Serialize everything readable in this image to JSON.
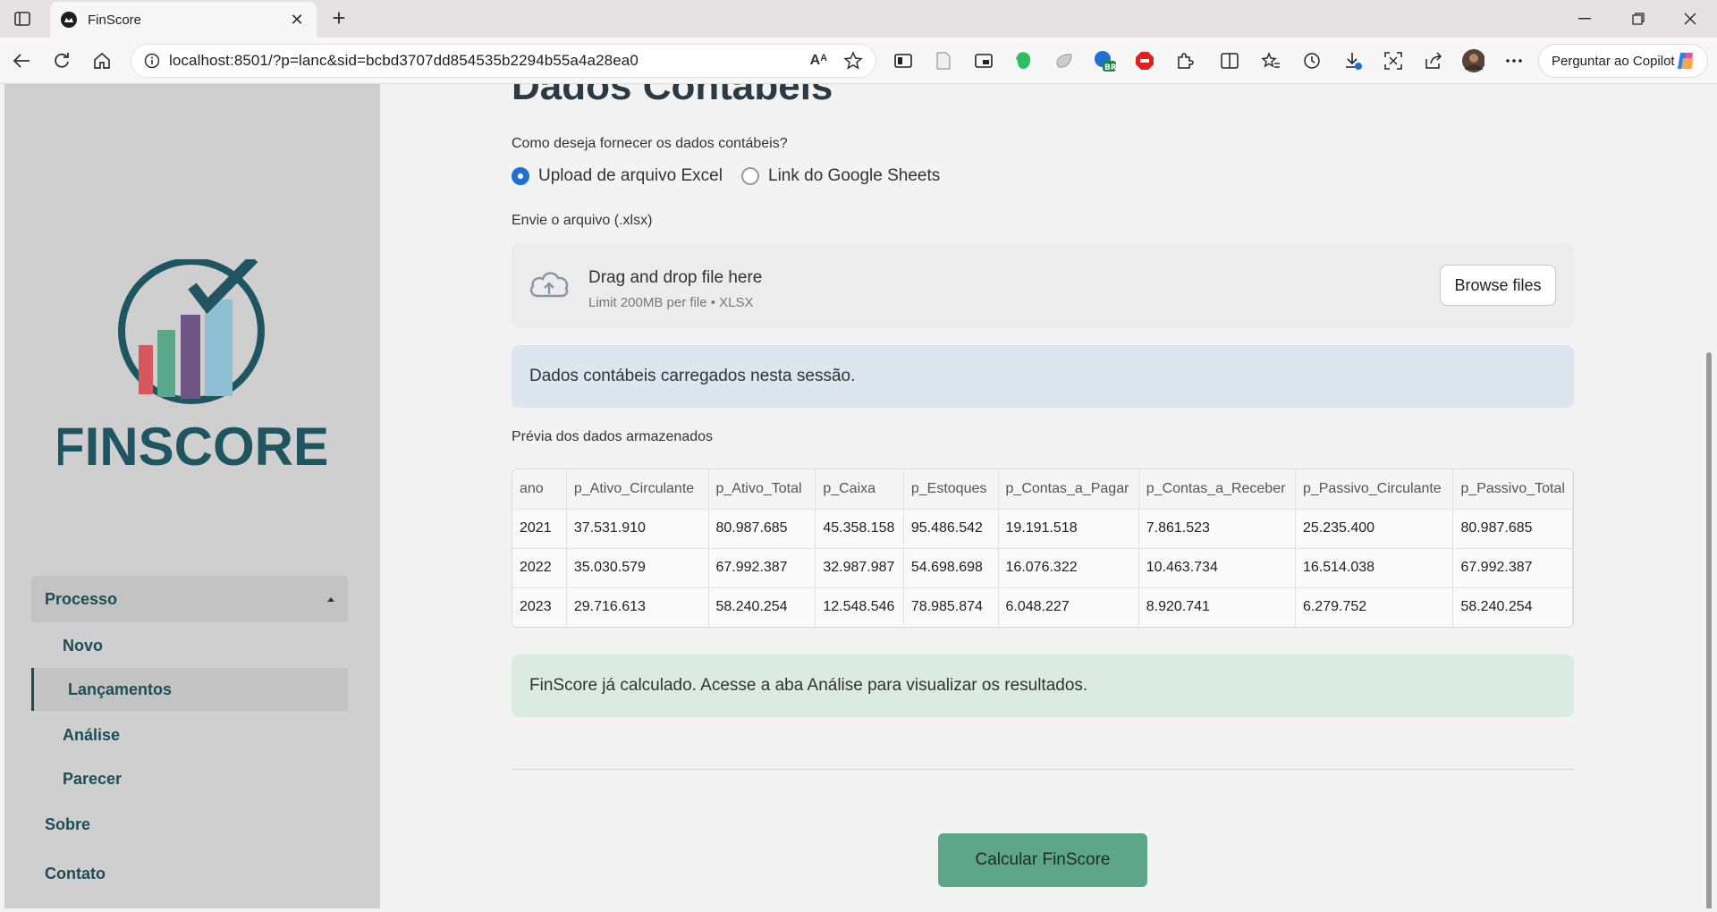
{
  "browser": {
    "tab_title": "FinScore",
    "url": "localhost:8501/?p=lanc&sid=bcbd3707dd854535b2294b55a4a28ea0",
    "read_aloud_label": "Aᴬ",
    "copilot_label": "Perguntar ao Copilot",
    "extension_badge": "BR"
  },
  "sidebar": {
    "brand": "FINSCORE",
    "group_label": "Processo",
    "sub_items": [
      {
        "label": "Novo"
      },
      {
        "label": "Lançamentos"
      },
      {
        "label": "Análise"
      },
      {
        "label": "Parecer"
      }
    ],
    "items": [
      {
        "label": "Sobre"
      },
      {
        "label": "Contato"
      }
    ],
    "logo_colors": [
      "#d7585d",
      "#5aa88b",
      "#6e5585",
      "#8fbfd3",
      "#1f5561"
    ]
  },
  "main": {
    "title": "Dados Contábeis",
    "question": "Como deseja fornecer os dados contábeis?",
    "radio_options": [
      {
        "label": "Upload de arquivo Excel",
        "selected": true
      },
      {
        "label": "Link do Google Sheets",
        "selected": false
      }
    ],
    "upload_label": "Envie o arquivo (.xlsx)",
    "dropzone_title": "Drag and drop file here",
    "dropzone_hint": "Limit 200MB per file • XLSX",
    "browse_label": "Browse files",
    "info_message": "Dados contábeis carregados nesta sessão.",
    "preview_label": "Prévia dos dados armazenados",
    "table": {
      "columns": [
        "ano",
        "p_Ativo_Circulante",
        "p_Ativo_Total",
        "p_Caixa",
        "p_Estoques",
        "p_Contas_a_Pagar",
        "p_Contas_a_Receber",
        "p_Passivo_Circulante",
        "p_Passivo_Total"
      ],
      "rows": [
        [
          "2021",
          "37.531.910",
          "80.987.685",
          "45.358.158",
          "95.486.542",
          "19.191.518",
          "7.861.523",
          "25.235.400",
          "80.987.685"
        ],
        [
          "2022",
          "35.030.579",
          "67.992.387",
          "32.987.987",
          "54.698.698",
          "16.076.322",
          "10.463.734",
          "16.514.038",
          "67.992.387"
        ],
        [
          "2023",
          "29.716.613",
          "58.240.254",
          "12.548.546",
          "78.985.874",
          "6.048.227",
          "8.920.741",
          "6.279.752",
          "58.240.254"
        ]
      ]
    },
    "success_message": "FinScore já calculado. Acesse a aba Análise para visualizar os resultados.",
    "calc_button": "Calcular FinScore"
  },
  "colors": {
    "accent": "#1e6fd6",
    "brand_dark": "#1f5561",
    "button_green": "#5ea68a",
    "info_bg": "#dde5ee",
    "success_bg": "#dcebe1"
  }
}
